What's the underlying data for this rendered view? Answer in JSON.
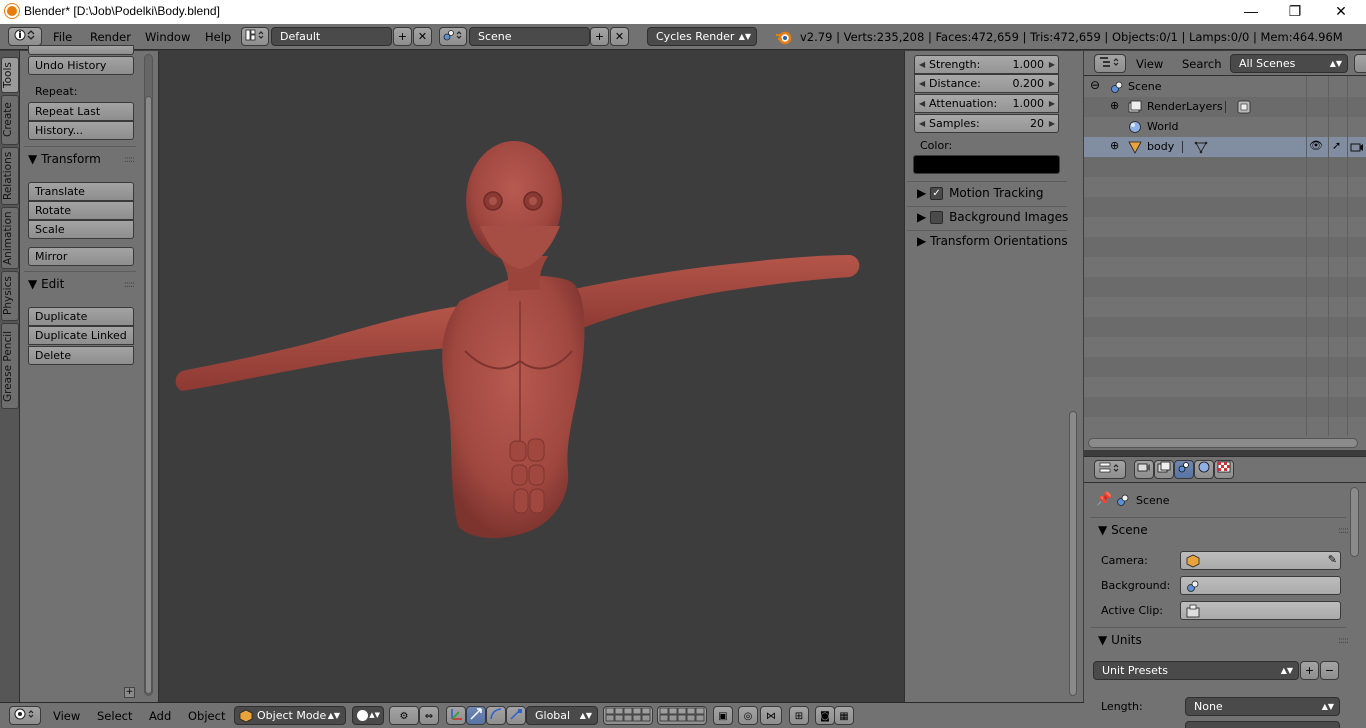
{
  "window": {
    "title": "Blender* [D:\\Job\\Podelki\\Body.blend]",
    "minimize": "—",
    "restore": "❐",
    "close": "✕"
  },
  "info_header": {
    "menus": [
      "File",
      "Render",
      "Window",
      "Help"
    ],
    "screen_layout": "Default",
    "scene": "Scene",
    "render_engine": "Cycles Render",
    "stats": "v2.79 | Verts:235,208 | Faces:472,659 | Tris:472,659 | Objects:0/1 | Lamps:0/0 | Mem:464.96M"
  },
  "left_tabs": [
    "Tools",
    "Create",
    "Relations",
    "Animation",
    "Physics",
    "Grease Pencil"
  ],
  "tool_shelf": {
    "undo_history": "Undo History",
    "repeat_label": "Repeat:",
    "repeat_last": "Repeat Last",
    "history": "History...",
    "transform_header": "Transform",
    "translate": "Translate",
    "rotate": "Rotate",
    "scale": "Scale",
    "mirror": "Mirror",
    "edit_header": "Edit",
    "duplicate": "Duplicate",
    "duplicate_linked": "Duplicate Linked",
    "delete": "Delete"
  },
  "n_panel": {
    "strength_label": "Strength:",
    "strength_value": "1.000",
    "distance_label": "Distance:",
    "distance_value": "0.200",
    "attenuation_label": "Attenuation:",
    "attenuation_value": "1.000",
    "samples_label": "Samples:",
    "samples_value": "20",
    "color_label": "Color:",
    "color_value": "#000000",
    "motion_tracking": "Motion Tracking",
    "background_images": "Background Images",
    "transform_orientations": "Transform Orientations"
  },
  "outliner": {
    "view": "View",
    "search": "Search",
    "display_mode": "All Scenes",
    "rows": {
      "scene": "Scene",
      "renderlayers": "RenderLayers",
      "world": "World",
      "body": "body"
    }
  },
  "properties": {
    "context_label": "Scene",
    "scene_header": "Scene",
    "camera_label": "Camera:",
    "background_label": "Background:",
    "active_clip_label": "Active Clip:",
    "units_header": "Units",
    "unit_presets": "Unit Presets",
    "length_label": "Length:",
    "length_value": "None"
  },
  "bottom_header": {
    "view": "View",
    "select": "Select",
    "add": "Add",
    "object": "Object",
    "mode": "Object Mode",
    "orientation": "Global"
  },
  "colors": {
    "model": "#a84e45",
    "viewport_bg": "#3d3d3d",
    "panel_bg": "#727272",
    "selection": "#818da0"
  }
}
